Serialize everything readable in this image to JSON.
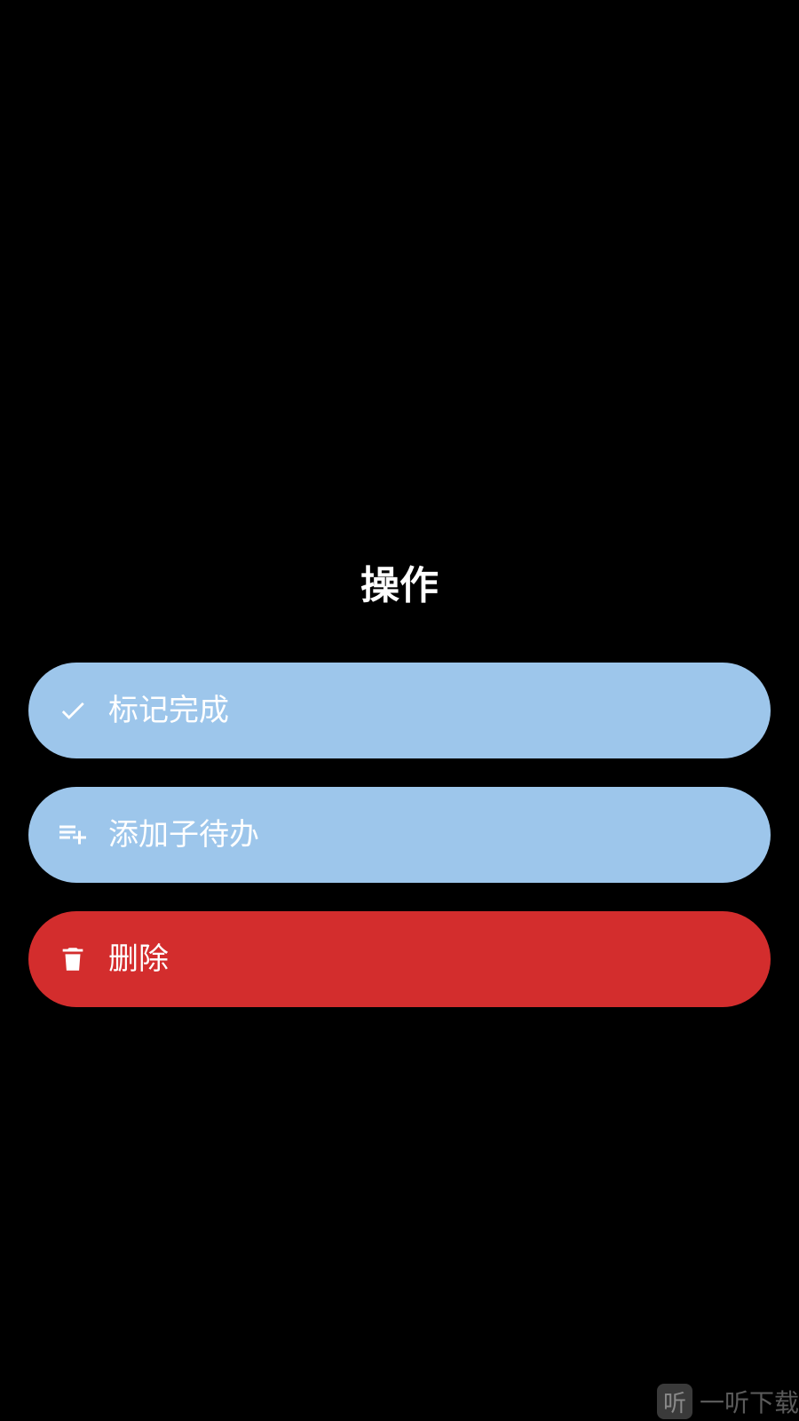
{
  "dialog": {
    "title": "操作",
    "actions": [
      {
        "id": "mark-complete",
        "label": "标记完成",
        "icon": "check-icon",
        "color": "#9DC6EB"
      },
      {
        "id": "add-sub-todo",
        "label": "添加子待办",
        "icon": "playlist-add-icon",
        "color": "#9DC6EB"
      },
      {
        "id": "delete",
        "label": "删除",
        "icon": "trash-icon",
        "color": "#D32D2D"
      }
    ]
  },
  "watermark": {
    "logo_char": "听",
    "text": "一听下载"
  },
  "colors": {
    "background": "#000000",
    "primary_button": "#9DC6EB",
    "danger_button": "#D32D2D",
    "text": "#FFFFFF"
  }
}
